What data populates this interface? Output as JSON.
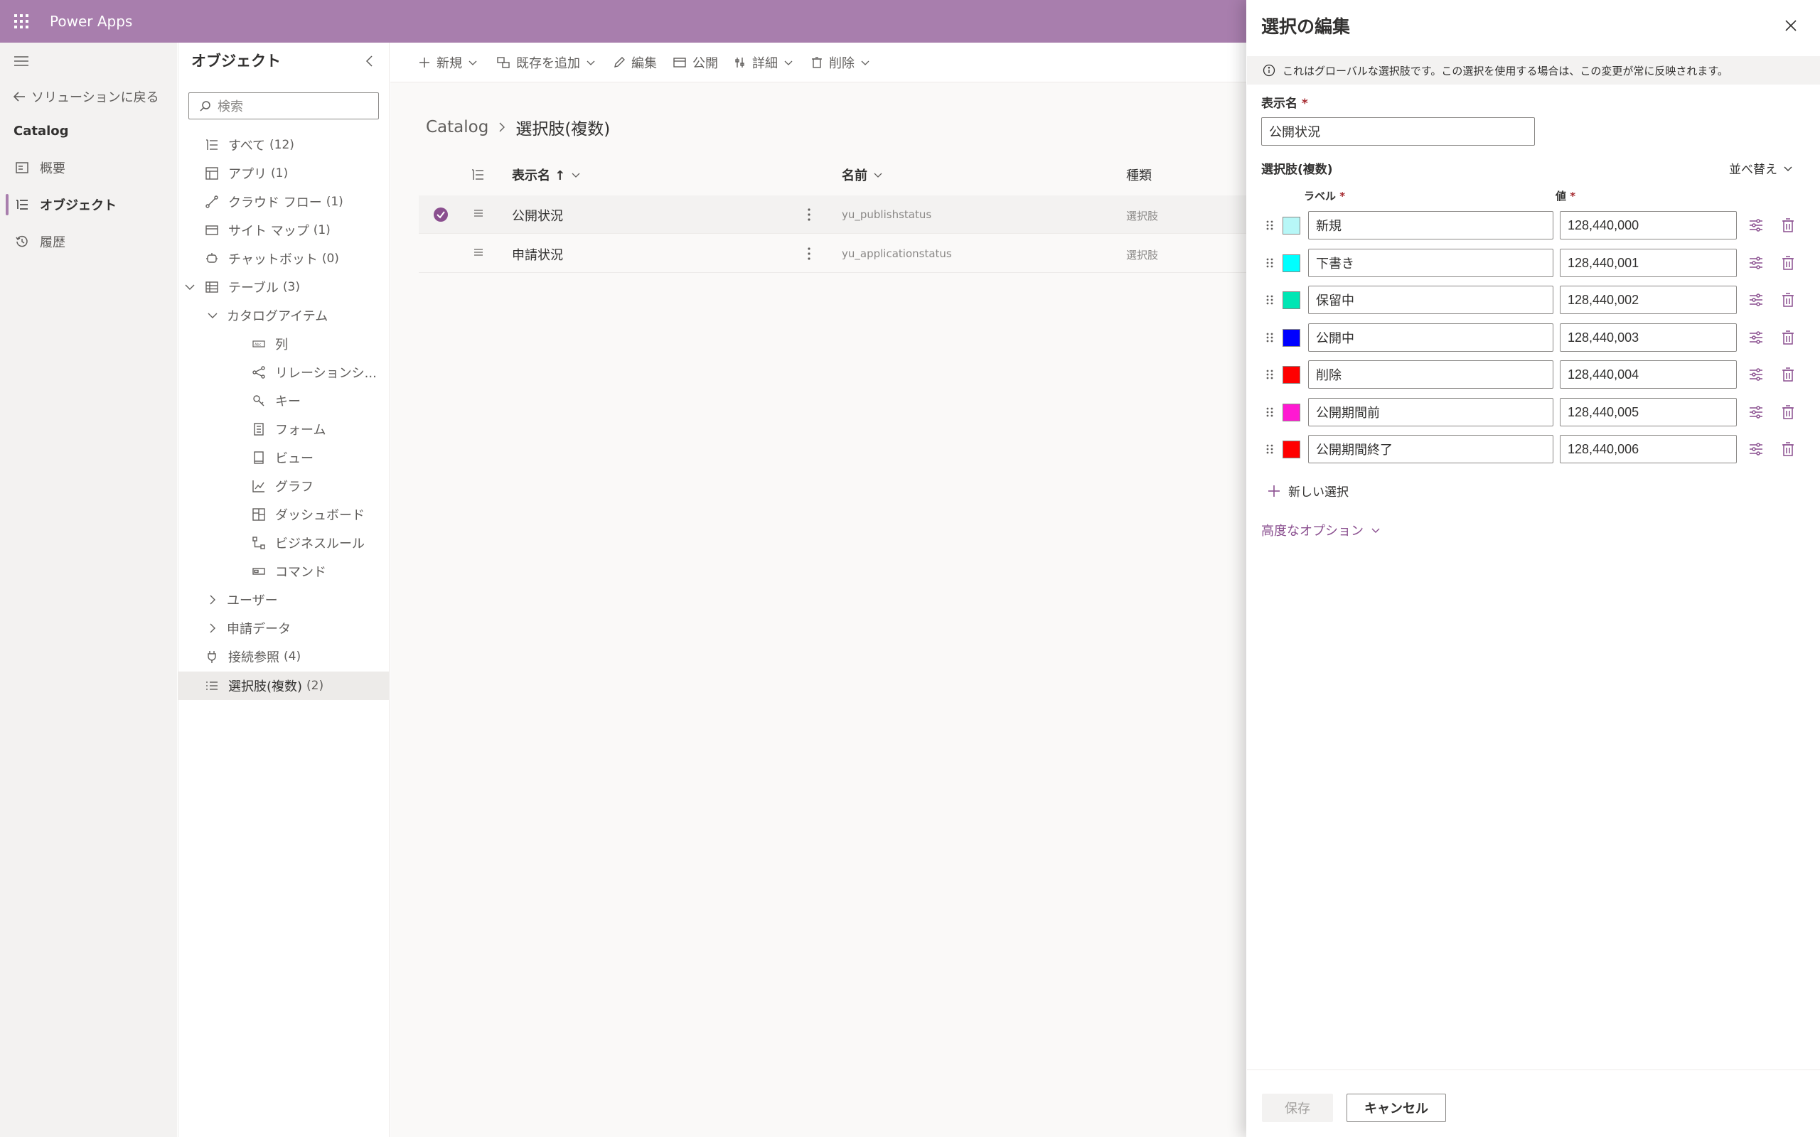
{
  "app": {
    "title": "Power Apps"
  },
  "leftnav": {
    "back": "ソリューションに戻る",
    "solution": "Catalog",
    "items": [
      {
        "label": "概要",
        "icon": "overview-icon"
      },
      {
        "label": "オブジェクト",
        "icon": "objects-icon",
        "selected": true
      },
      {
        "label": "履歴",
        "icon": "history-icon"
      }
    ]
  },
  "objects_panel": {
    "title": "オブジェクト",
    "search_placeholder": "検索",
    "items": [
      {
        "label": "すべて",
        "count": "(12)"
      },
      {
        "label": "アプリ",
        "count": "(1)"
      },
      {
        "label": "クラウド フロー",
        "count": "(1)"
      },
      {
        "label": "サイト マップ",
        "count": "(1)"
      },
      {
        "label": "チャットボット",
        "count": "(0)"
      },
      {
        "label": "テーブル",
        "count": "(3)"
      },
      {
        "label": "カタログアイテム",
        "count": ""
      },
      {
        "label": "列",
        "count": ""
      },
      {
        "label": "リレーションシ...",
        "count": ""
      },
      {
        "label": "キー",
        "count": ""
      },
      {
        "label": "フォーム",
        "count": ""
      },
      {
        "label": "ビュー",
        "count": ""
      },
      {
        "label": "グラフ",
        "count": ""
      },
      {
        "label": "ダッシュボード",
        "count": ""
      },
      {
        "label": "ビジネスルール",
        "count": ""
      },
      {
        "label": "コマンド",
        "count": ""
      },
      {
        "label": "ユーザー",
        "count": ""
      },
      {
        "label": "申請データ",
        "count": ""
      },
      {
        "label": "接続参照",
        "count": "(4)"
      },
      {
        "label": "選択肢(複数)",
        "count": "(2)"
      }
    ]
  },
  "commandbar": {
    "new": "新規",
    "add_existing": "既存を追加",
    "edit": "編集",
    "publish": "公開",
    "details": "詳細",
    "delete": "削除"
  },
  "breadcrumb": {
    "root": "Catalog",
    "current": "選択肢(複数)"
  },
  "grid": {
    "columns": {
      "display_name": "表示名 ↑",
      "name": "名前",
      "type": "種類"
    },
    "rows": [
      {
        "display_name": "公開状況",
        "name": "yu_publishstatus",
        "type": "選択肢",
        "selected": true
      },
      {
        "display_name": "申請状況",
        "name": "yu_applicationstatus",
        "type": "選択肢",
        "selected": false
      }
    ]
  },
  "edit_panel": {
    "title": "選択の編集",
    "info": "これはグローバルな選択肢です。この選択を使用する場合は、この変更が常に反映されます。",
    "display_name_label": "表示名",
    "display_name_value": "公開状況",
    "required_mark": "*",
    "choices_label": "選択肢(複数)",
    "sort_label": "並べ替え",
    "col_label": "ラベル",
    "col_value": "値",
    "choices": [
      {
        "label": "新規",
        "value": "128,440,000",
        "color": "#b7f7f7"
      },
      {
        "label": "下書き",
        "value": "128,440,001",
        "color": "#00ffff"
      },
      {
        "label": "保留中",
        "value": "128,440,002",
        "color": "#00e6b4"
      },
      {
        "label": "公開中",
        "value": "128,440,003",
        "color": "#0000ff"
      },
      {
        "label": "削除",
        "value": "128,440,004",
        "color": "#ff0000"
      },
      {
        "label": "公開期間前",
        "value": "128,440,005",
        "color": "#ff19d2"
      },
      {
        "label": "公開期間終了",
        "value": "128,440,006",
        "color": "#ff0000"
      }
    ],
    "new_choice": "新しい選択",
    "advanced": "高度なオプション",
    "save": "保存",
    "cancel": "キャンセル"
  },
  "colors": {
    "accent": "#a87ead",
    "accent_text": "#8a4f8f"
  }
}
